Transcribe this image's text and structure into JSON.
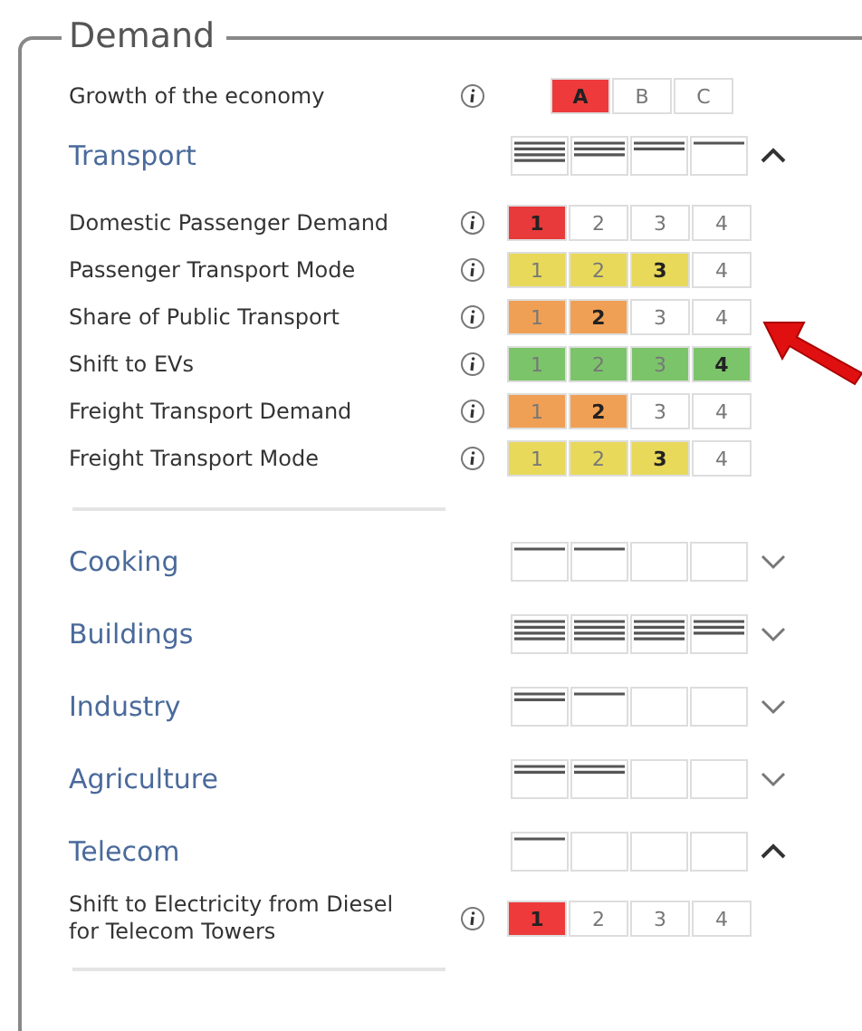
{
  "panel": {
    "title": "Demand"
  },
  "economy": {
    "label": "Growth of the economy",
    "color": "#ee3a3a",
    "options": [
      {
        "label": "A",
        "on": true
      },
      {
        "label": "B",
        "on": false
      },
      {
        "label": "C",
        "on": false
      }
    ]
  },
  "sections": [
    {
      "name": "Transport",
      "expanded": true,
      "bars": [
        {
          "kind": "full"
        },
        {
          "kind": "three"
        },
        {
          "kind": "half"
        },
        {
          "kind": "quarter"
        }
      ],
      "levers": [
        {
          "label": "Domestic Passenger Demand",
          "color": "#e83a3a",
          "options": [
            {
              "label": "1",
              "on": true
            },
            {
              "label": "2",
              "on": false
            },
            {
              "label": "3",
              "on": false
            },
            {
              "label": "4",
              "on": false
            }
          ]
        },
        {
          "label": "Passenger Transport Mode",
          "color": "#e8d95a",
          "options": [
            {
              "label": "1",
              "on": true
            },
            {
              "label": "2",
              "on": true
            },
            {
              "label": "3",
              "on": true
            },
            {
              "label": "4",
              "on": false
            }
          ]
        },
        {
          "label": "Share of Public Transport",
          "color": "#f0a055",
          "options": [
            {
              "label": "1",
              "on": true
            },
            {
              "label": "2",
              "on": true
            },
            {
              "label": "3",
              "on": false
            },
            {
              "label": "4",
              "on": false
            }
          ]
        },
        {
          "label": "Shift to EVs",
          "color": "#7cc46a",
          "options": [
            {
              "label": "1",
              "on": true
            },
            {
              "label": "2",
              "on": true
            },
            {
              "label": "3",
              "on": true
            },
            {
              "label": "4",
              "on": true
            }
          ]
        },
        {
          "label": "Freight Transport Demand",
          "color": "#f0a055",
          "options": [
            {
              "label": "1",
              "on": true
            },
            {
              "label": "2",
              "on": true
            },
            {
              "label": "3",
              "on": false
            },
            {
              "label": "4",
              "on": false
            }
          ]
        },
        {
          "label": "Freight Transport Mode",
          "color": "#e8d95a",
          "options": [
            {
              "label": "1",
              "on": true
            },
            {
              "label": "2",
              "on": true
            },
            {
              "label": "3",
              "on": true
            },
            {
              "label": "4",
              "on": false
            }
          ]
        }
      ]
    },
    {
      "name": "Cooking",
      "expanded": false,
      "bars": [
        {
          "kind": "quarter"
        },
        {
          "kind": "quarter"
        },
        {
          "kind": "empty"
        },
        {
          "kind": "empty"
        }
      ]
    },
    {
      "name": "Buildings",
      "expanded": false,
      "bars": [
        {
          "kind": "full"
        },
        {
          "kind": "full"
        },
        {
          "kind": "full"
        },
        {
          "kind": "three"
        }
      ]
    },
    {
      "name": "Industry",
      "expanded": false,
      "bars": [
        {
          "kind": "half"
        },
        {
          "kind": "quarter"
        },
        {
          "kind": "empty"
        },
        {
          "kind": "empty"
        }
      ]
    },
    {
      "name": "Agriculture",
      "expanded": false,
      "bars": [
        {
          "kind": "half"
        },
        {
          "kind": "half"
        },
        {
          "kind": "empty"
        },
        {
          "kind": "empty"
        }
      ]
    },
    {
      "name": "Telecom",
      "expanded": true,
      "bars": [
        {
          "kind": "quarter"
        },
        {
          "kind": "empty"
        },
        {
          "kind": "empty"
        },
        {
          "kind": "empty"
        }
      ],
      "levers": [
        {
          "label": "Shift to Electricity from Diesel for Telecom Towers",
          "color": "#ee3a3a",
          "options": [
            {
              "label": "1",
              "on": true
            },
            {
              "label": "2",
              "on": false
            },
            {
              "label": "3",
              "on": false
            },
            {
              "label": "4",
              "on": false
            }
          ]
        }
      ]
    }
  ]
}
